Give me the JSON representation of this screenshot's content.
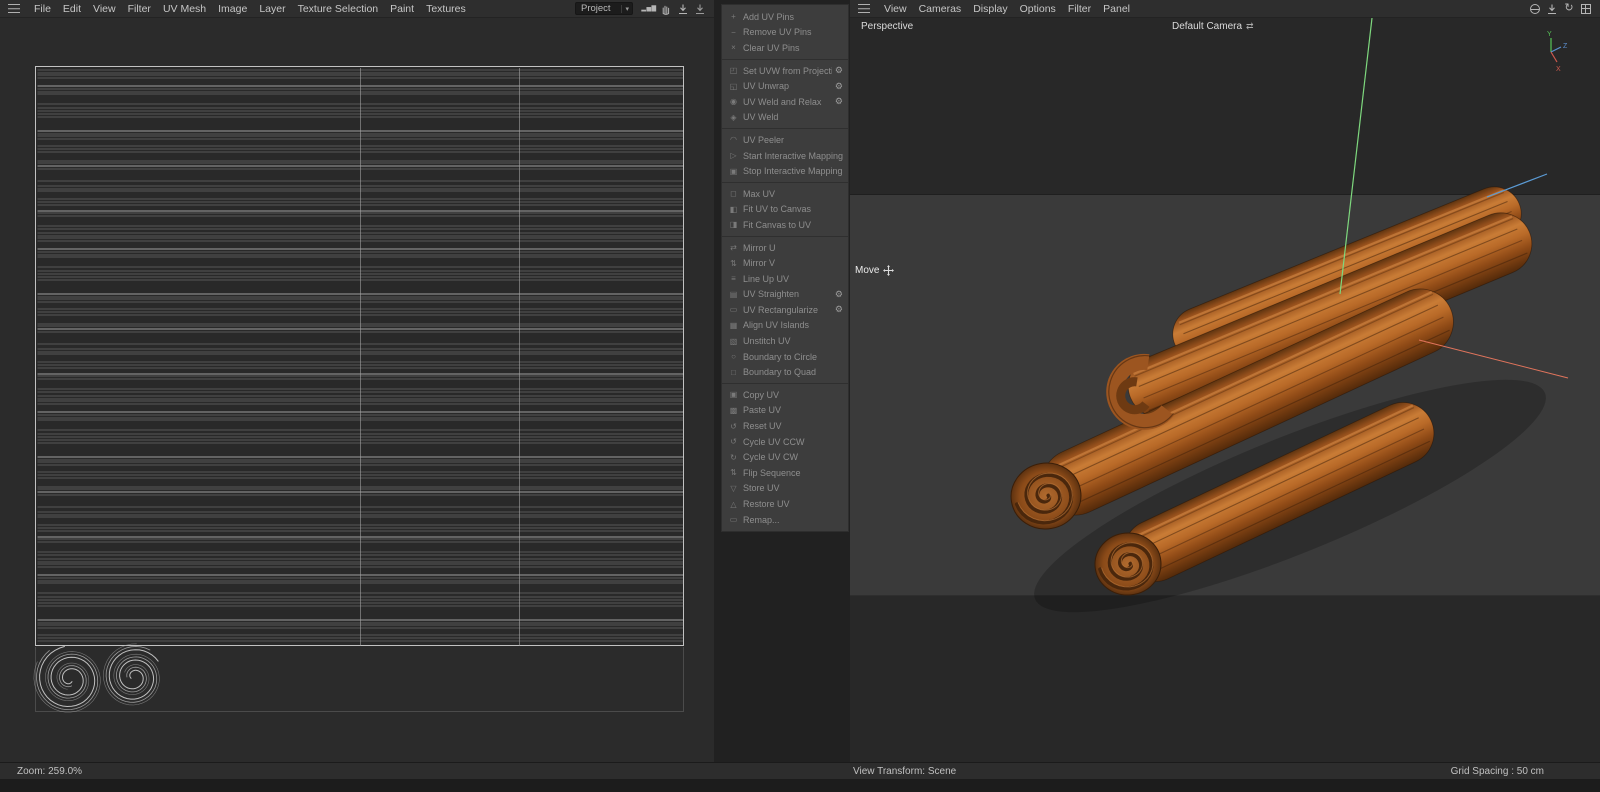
{
  "icons": {
    "caret": "▾",
    "chart": "▂▅▇",
    "gear": "⚙",
    "refresh": "↻",
    "camera_swap": "⇄"
  },
  "colors": {
    "axis_x_red": "#cf5a4e",
    "axis_y_green": "#58c458",
    "axis_z_blue": "#5b8fd0",
    "cinnamon_brown": "#a9571b",
    "panel_bg": "#3d3d3d"
  },
  "left_panel": {
    "menu": [
      "File",
      "Edit",
      "View",
      "Filter",
      "UV Mesh",
      "Image",
      "Layer",
      "Texture Selection",
      "Paint",
      "Textures"
    ],
    "project_select": {
      "value": "Project"
    },
    "status": {
      "zoom": "Zoom: 259.0%"
    }
  },
  "command_panel": {
    "groups": [
      {
        "items": [
          {
            "label": "Add UV Pins",
            "icon": "+"
          },
          {
            "label": "Remove UV Pins",
            "icon": "−"
          },
          {
            "label": "Clear UV Pins",
            "icon": "×"
          }
        ]
      },
      {
        "items": [
          {
            "label": "Set UVW from Projection",
            "icon": "◰",
            "gear": true
          },
          {
            "label": "UV Unwrap",
            "icon": "◱",
            "gear": true
          },
          {
            "label": "UV Weld and Relax",
            "icon": "◉",
            "gear": true
          },
          {
            "label": "UV Weld",
            "icon": "◈"
          }
        ]
      },
      {
        "items": [
          {
            "label": "UV Peeler",
            "icon": "◠"
          },
          {
            "label": "Start Interactive Mapping",
            "icon": "▷"
          },
          {
            "label": "Stop Interactive Mapping",
            "icon": "▣"
          }
        ]
      },
      {
        "items": [
          {
            "label": "Max UV",
            "icon": "◻"
          },
          {
            "label": "Fit UV to Canvas",
            "icon": "◧"
          },
          {
            "label": "Fit Canvas to UV",
            "icon": "◨"
          }
        ]
      },
      {
        "items": [
          {
            "label": "Mirror U",
            "icon": "⇄"
          },
          {
            "label": "Mirror V",
            "icon": "⇅"
          },
          {
            "label": "Line Up UV",
            "icon": "≡"
          },
          {
            "label": "UV Straighten",
            "icon": "▤",
            "gear": true
          },
          {
            "label": "UV Rectangularize",
            "icon": "▭",
            "gear": true
          },
          {
            "label": "Align UV Islands",
            "icon": "▦"
          },
          {
            "label": "Unstitch UV",
            "icon": "▧"
          },
          {
            "label": "Boundary to Circle",
            "icon": "○"
          },
          {
            "label": "Boundary to Quad",
            "icon": "□"
          }
        ]
      },
      {
        "items": [
          {
            "label": "Copy UV",
            "icon": "▣"
          },
          {
            "label": "Paste UV",
            "icon": "▩"
          },
          {
            "label": "Reset UV",
            "icon": "↺"
          },
          {
            "label": "Cycle UV CCW",
            "icon": "↺"
          },
          {
            "label": "Cycle UV CW",
            "icon": "↻"
          },
          {
            "label": "Flip Sequence",
            "icon": "⇅"
          },
          {
            "label": "Store UV",
            "icon": "▽"
          },
          {
            "label": "Restore UV",
            "icon": "△"
          },
          {
            "label": "Remap...",
            "icon": "▭"
          }
        ]
      }
    ]
  },
  "viewport": {
    "menu": [
      "View",
      "Cameras",
      "Display",
      "Options",
      "Filter",
      "Panel"
    ],
    "perspective_label": "Perspective",
    "camera_label": "Default Camera",
    "tool_label": "Move",
    "axis_labels": {
      "x": "X",
      "y": "Y",
      "z": "Z"
    },
    "status_left": "View Transform: Scene",
    "status_right": "Grid Spacing : 50 cm"
  }
}
